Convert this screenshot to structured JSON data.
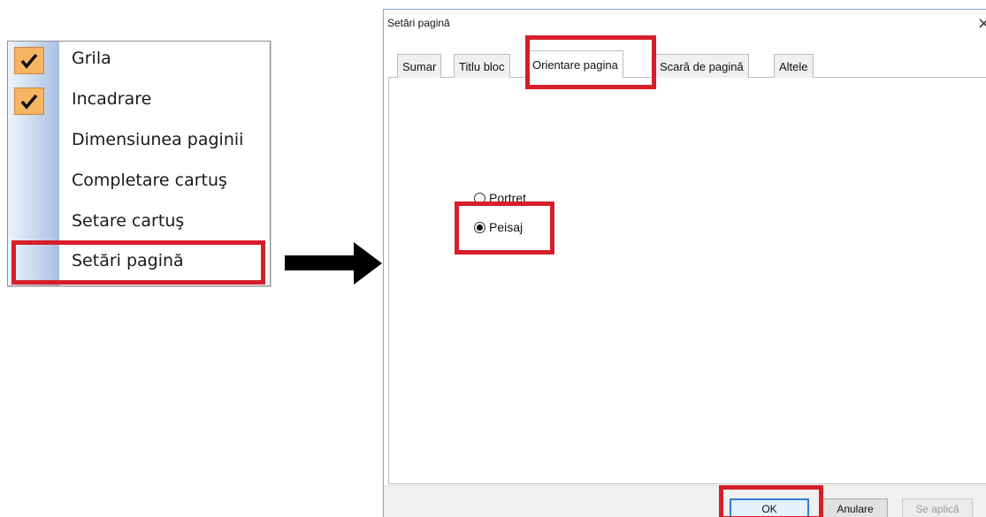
{
  "context_menu": {
    "items": [
      {
        "label": "Grila",
        "checked": true
      },
      {
        "label": "Incadrare",
        "checked": true
      },
      {
        "label": "Dimensiunea paginii",
        "checked": false
      },
      {
        "label": "Completare cartuş",
        "checked": false
      },
      {
        "label": "Setare cartuş",
        "checked": false
      },
      {
        "label": "Setări pagină",
        "checked": false,
        "highlighted": true
      }
    ]
  },
  "dialog": {
    "title": "Setări pagină",
    "close_symbol": "×",
    "tabs": [
      {
        "label": "Sumar"
      },
      {
        "label": "Titlu bloc"
      },
      {
        "label": "Orientare pagina",
        "active": true
      },
      {
        "label": "Scară de pagină"
      },
      {
        "label": "Altele"
      }
    ],
    "orientation": {
      "options": [
        {
          "label": "Portret",
          "selected": false
        },
        {
          "label": "Peisaj",
          "selected": true
        }
      ]
    },
    "buttons": {
      "ok": "OK",
      "cancel": "Anulare",
      "apply": "Se aplică"
    }
  },
  "colors": {
    "highlight": "#d61f2a",
    "check_bg": "#f7b463",
    "default_button_border": "#2d7fd6"
  }
}
